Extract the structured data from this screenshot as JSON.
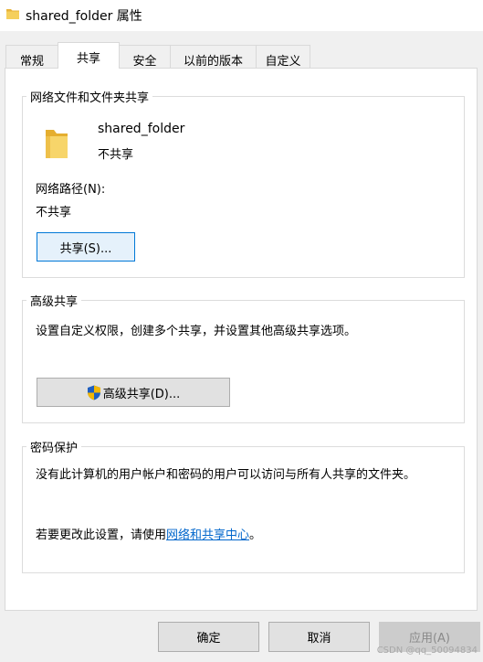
{
  "window": {
    "title": "shared_folder 属性",
    "icon": "folder-icon"
  },
  "tabs": [
    {
      "label": "常规",
      "active": false
    },
    {
      "label": "共享",
      "active": true
    },
    {
      "label": "安全",
      "active": false
    },
    {
      "label": "以前的版本",
      "active": false
    },
    {
      "label": "自定义",
      "active": false
    }
  ],
  "network_sharing": {
    "group_title": "网络文件和文件夹共享",
    "folder_name": "shared_folder",
    "folder_status": "不共享",
    "path_label": "网络路径(N):",
    "path_value": "不共享",
    "share_button": "共享(S)..."
  },
  "advanced_sharing": {
    "group_title": "高级共享",
    "description": "设置自定义权限，创建多个共享，并设置其他高级共享选项。",
    "button": "高级共享(D)...",
    "button_icon": "uac-shield-icon"
  },
  "password_protection": {
    "group_title": "密码保护",
    "description": "没有此计算机的用户帐户和密码的用户可以访问与所有人共享的文件夹。",
    "change_prefix": "若要更改此设置，请使用",
    "link_text": "网络和共享中心",
    "change_suffix": "。"
  },
  "footer": {
    "ok": "确定",
    "cancel": "取消",
    "apply": "应用(A)"
  },
  "watermark": "CSDN @qq_50094834",
  "colors": {
    "accent": "#0078d7",
    "link": "#0066cc",
    "folder": "#f2c94c"
  }
}
